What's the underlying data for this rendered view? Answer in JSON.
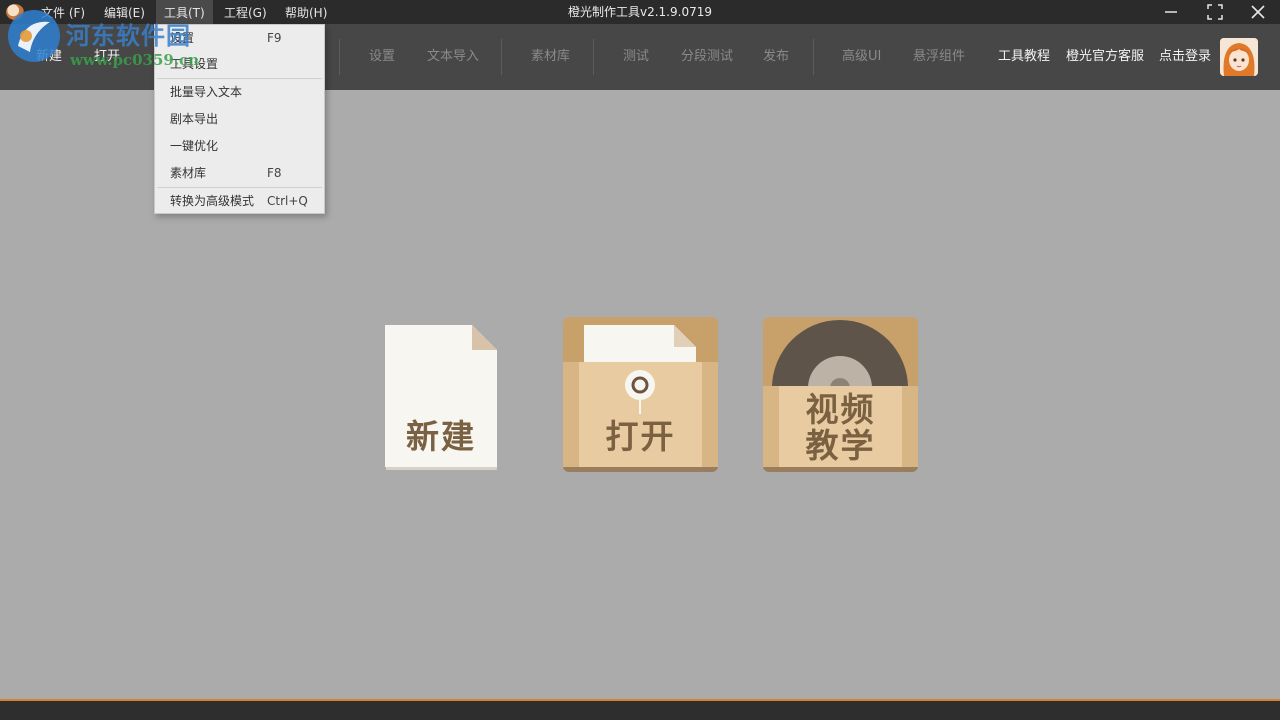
{
  "titlebar": {
    "title": "橙光制作工具v2.1.9.0719",
    "menus": [
      "文件 (F)",
      "编辑(E)",
      "工具(T)",
      "工程(G)",
      "帮助(H)"
    ]
  },
  "toolbar": {
    "new_label": "新建",
    "open_label": "打开",
    "items": [
      "设置",
      "文本导入",
      "素材库",
      "测试",
      "分段测试",
      "发布",
      "高级UI",
      "悬浮组件"
    ],
    "tutorial": "工具教程",
    "support": "橙光官方客服",
    "login": "点击登录"
  },
  "tools_menu": {
    "items": [
      {
        "label": "设置",
        "shortcut": "F9"
      },
      {
        "label": "工具设置",
        "shortcut": ""
      },
      {
        "label": "批量导入文本",
        "shortcut": ""
      },
      {
        "label": "剧本导出",
        "shortcut": ""
      },
      {
        "label": "一键优化",
        "shortcut": ""
      },
      {
        "label": "素材库",
        "shortcut": "F8"
      },
      {
        "label": "转换为高级模式",
        "shortcut": "Ctrl+Q"
      }
    ]
  },
  "main": {
    "new_button": "新建",
    "open_button": "打开",
    "video_line1": "视频",
    "video_line2": "教学"
  },
  "watermark": {
    "name": "河东软件园",
    "url": "www.pc0359.cn"
  },
  "colors": {
    "background": "#ababab",
    "toolbar": "#474747",
    "titlebar": "#2b2b2b",
    "accent": "#d4832e",
    "card_tan": "#c9a06c",
    "card_light": "#e8cba4",
    "label_brown": "#7a6142"
  },
  "icons": [
    "app-logo-icon",
    "minimize-icon",
    "maximize-icon",
    "close-icon",
    "avatar-icon"
  ]
}
